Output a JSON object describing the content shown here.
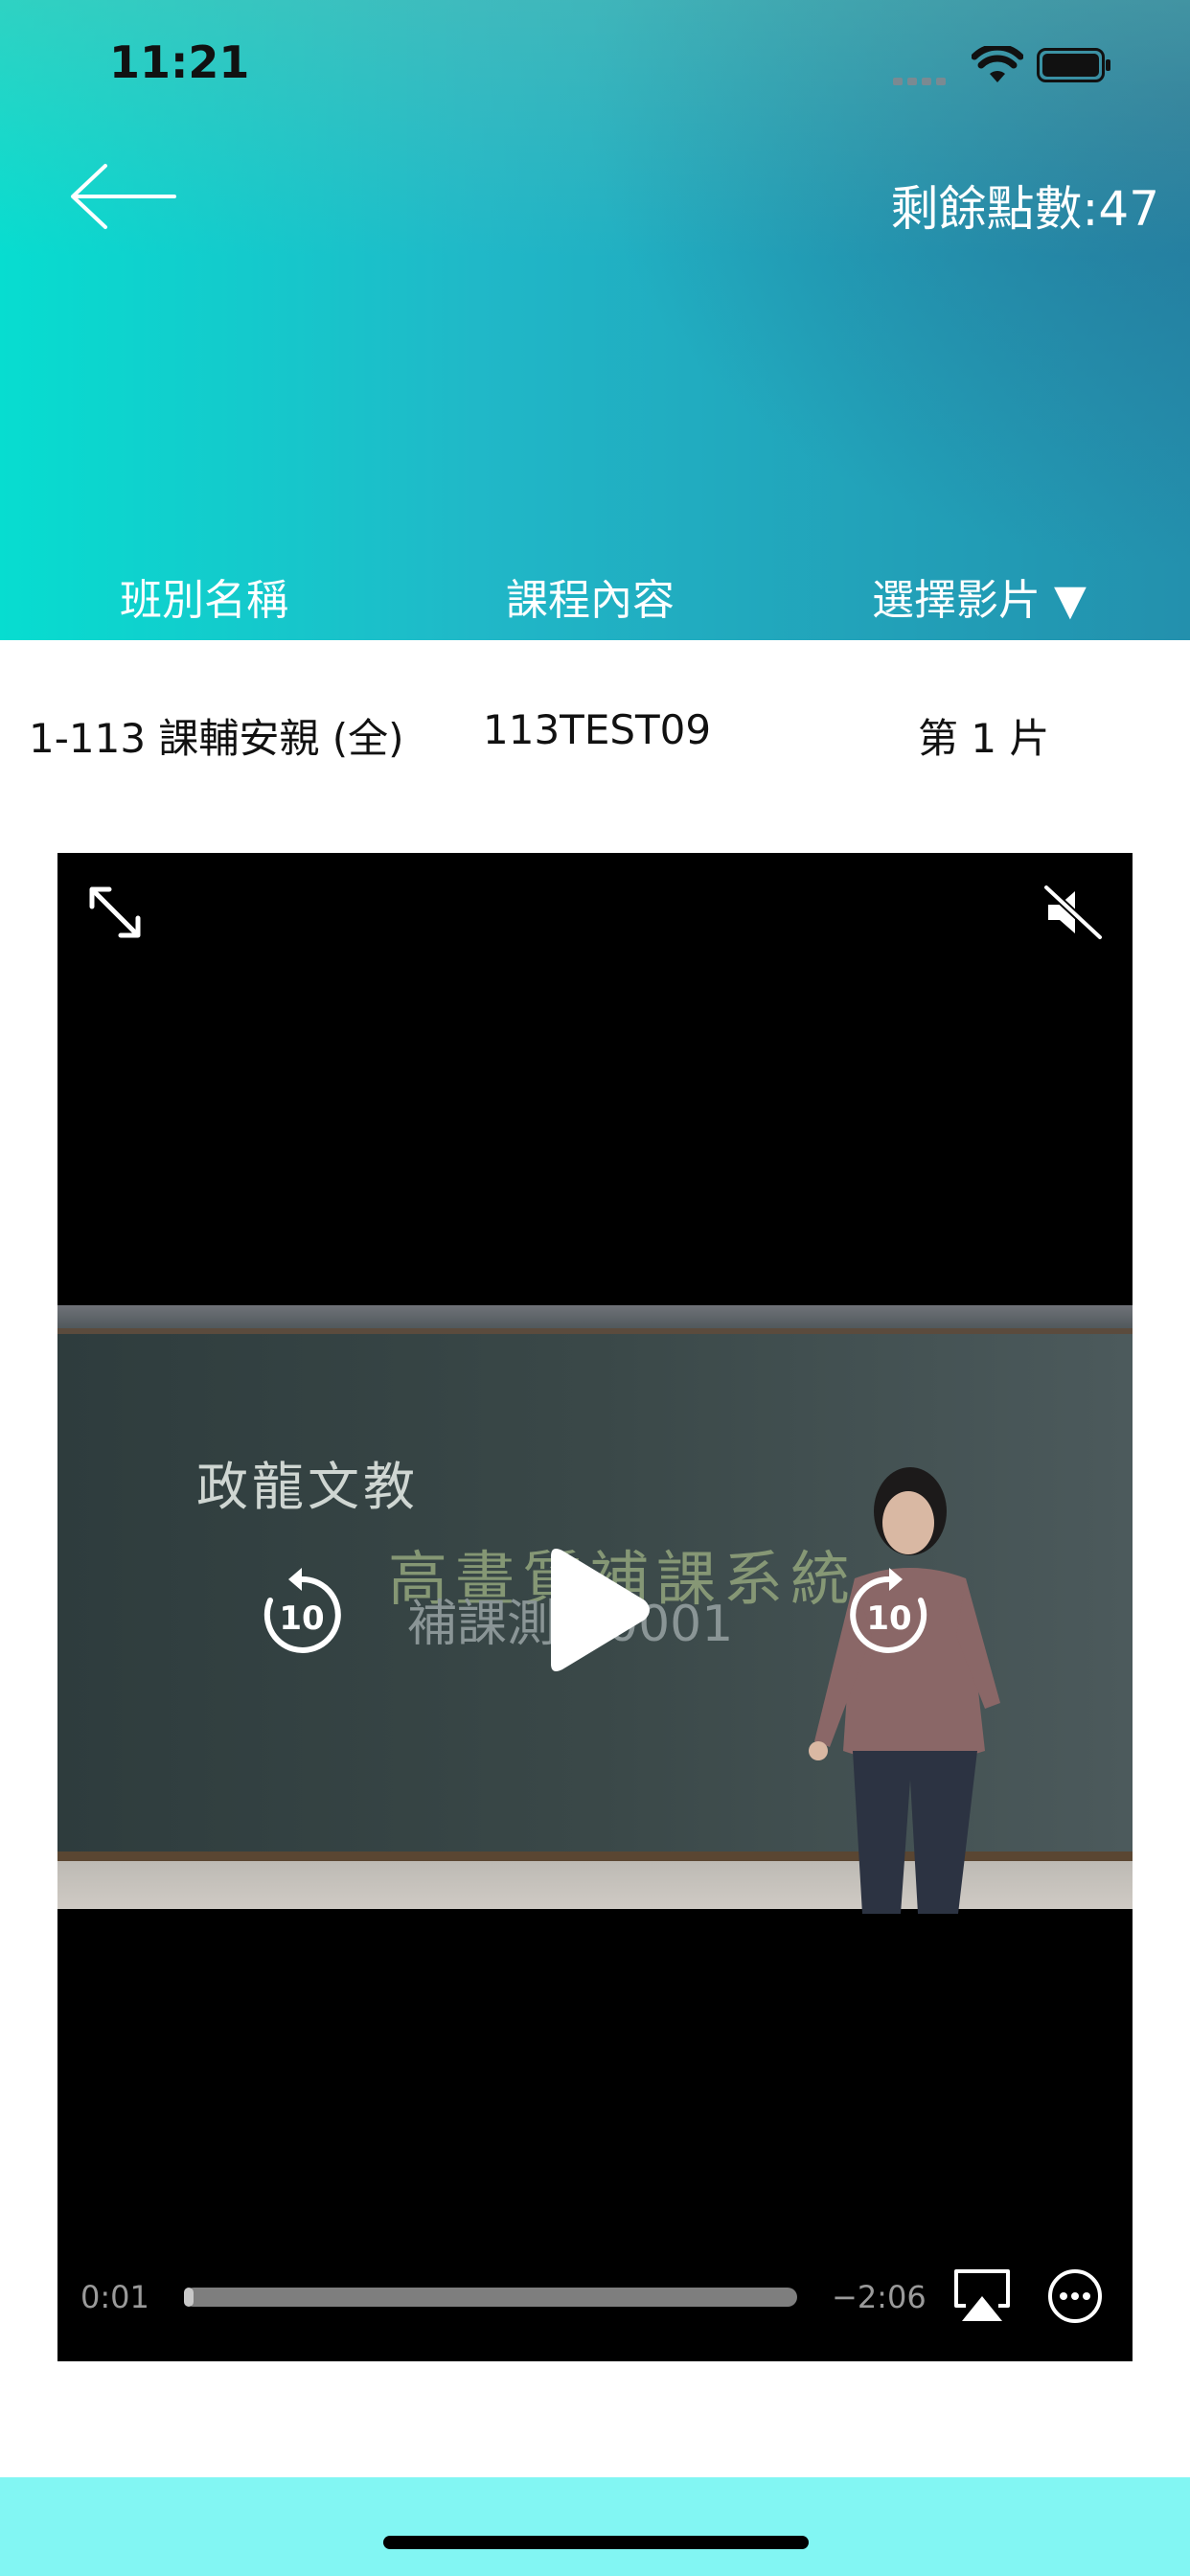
{
  "status_bar": {
    "time": "11:21",
    "icons": [
      "signal-icon",
      "wifi-icon",
      "battery-icon"
    ]
  },
  "header": {
    "back_icon": "arrow-left-icon",
    "points_label": "剩餘點數:47",
    "columns": {
      "class_name": "班別名稱",
      "course_content": "課程內容",
      "select_video": "選擇影片 ▼"
    }
  },
  "row": {
    "class_name": "1-113 課輔安親 (全)",
    "course_content": "113TEST09",
    "video_number": "第 1 片"
  },
  "player": {
    "elapsed": "0:01",
    "remaining": "−2:06",
    "progress": 0.008,
    "skip_back_seconds": "10",
    "skip_forward_seconds": "10",
    "icons": [
      "fullscreen-icon",
      "muted-speaker-icon",
      "skip-back-icon",
      "play-icon",
      "skip-forward-icon",
      "airplay-icon",
      "more-icon"
    ],
    "video_text": {
      "board_line1": "政龍文教",
      "board_line2": "高畫質補課系統",
      "board_line3": "補課測試0001"
    }
  },
  "colors": {
    "header_start": "#07ddd0",
    "header_end": "#2390ad",
    "bottom_bar": "#82f6f3"
  }
}
